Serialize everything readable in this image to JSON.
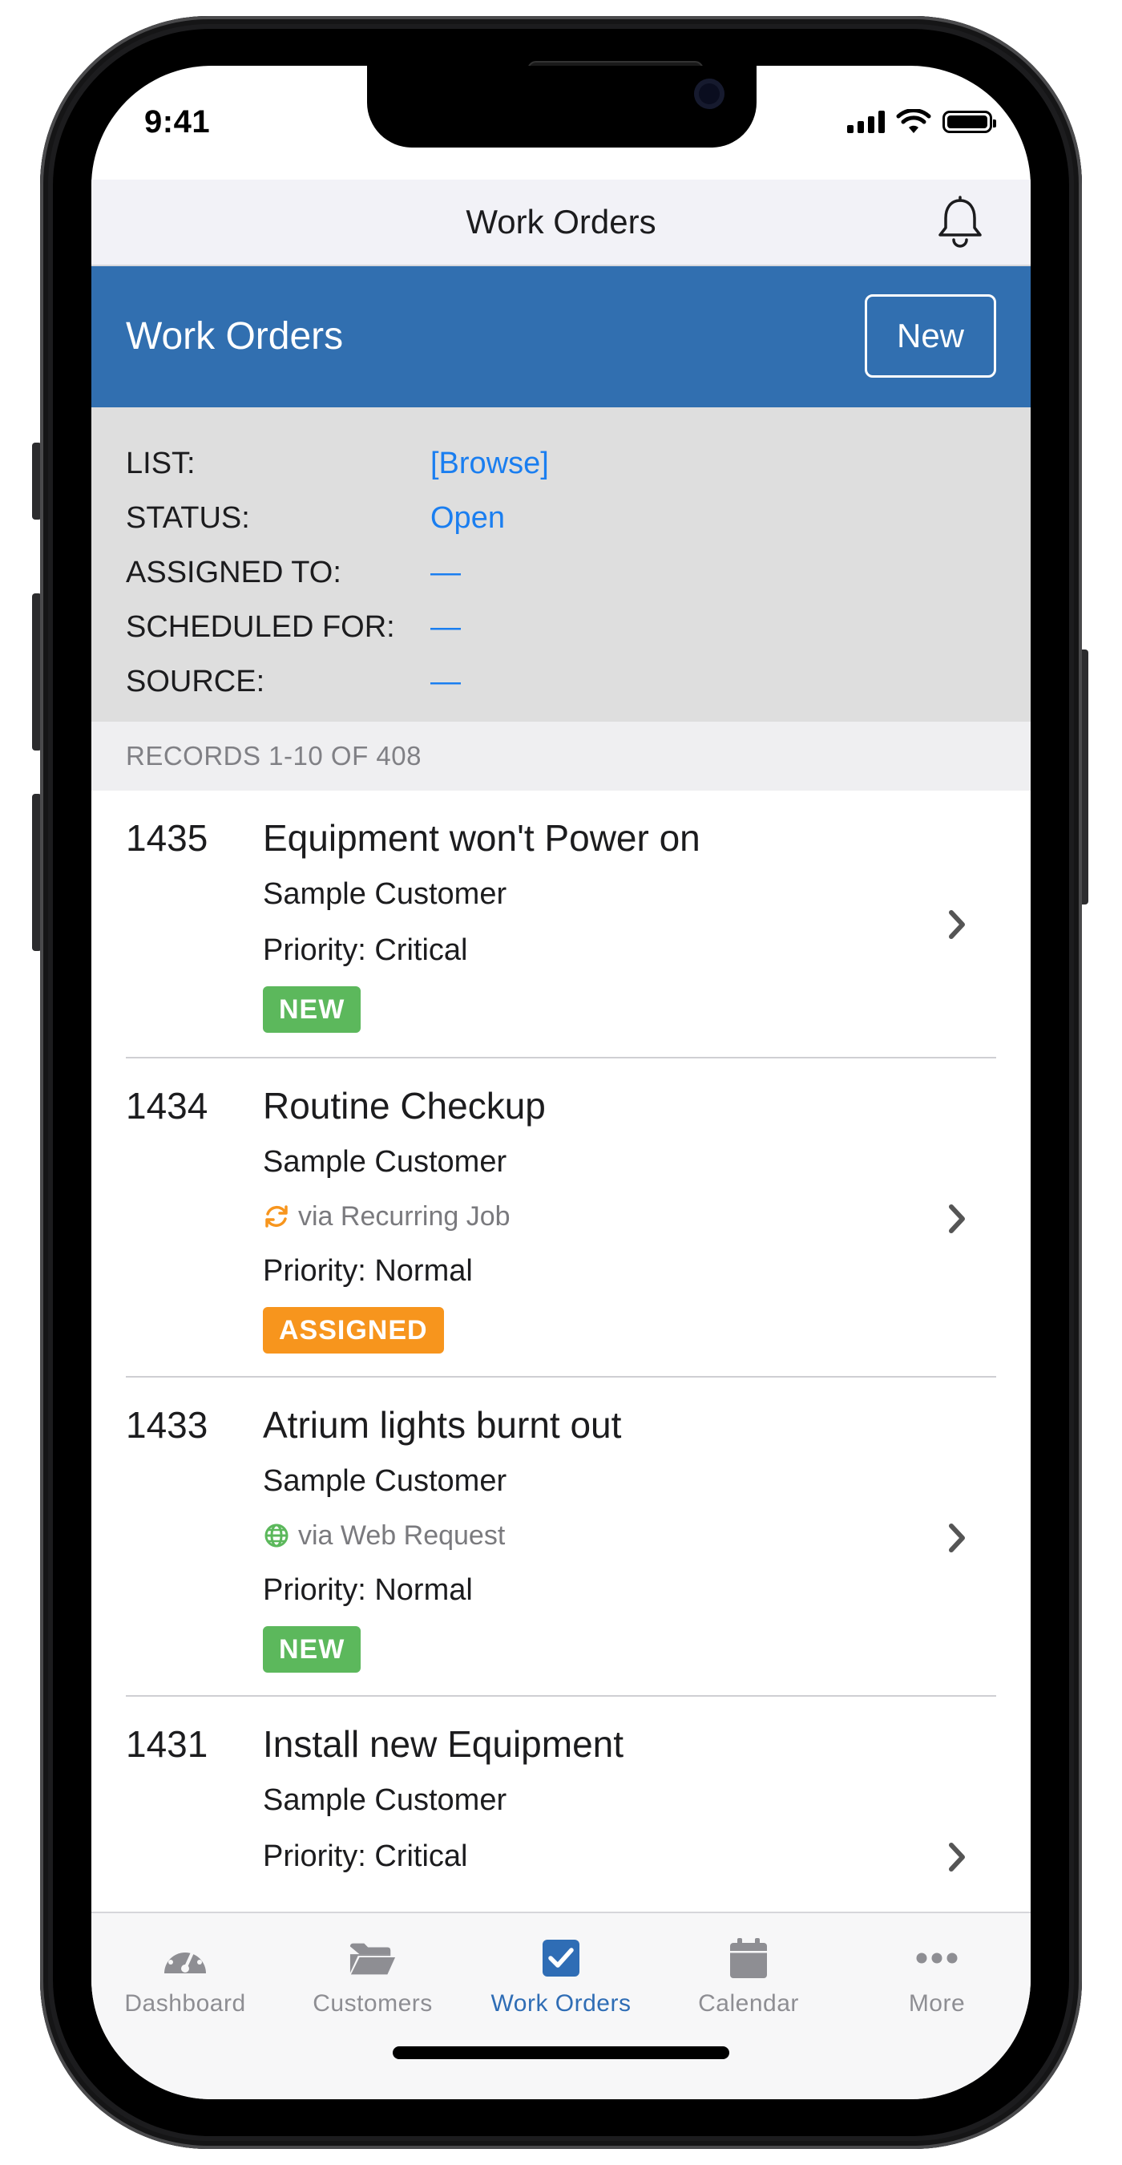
{
  "status_bar": {
    "time": "9:41"
  },
  "navbar": {
    "title": "Work Orders"
  },
  "header": {
    "title": "Work Orders",
    "new_label": "New"
  },
  "filters": [
    {
      "label": "LIST:",
      "value": "[Browse]"
    },
    {
      "label": "STATUS:",
      "value": "Open"
    },
    {
      "label": "ASSIGNED TO:",
      "value": "—"
    },
    {
      "label": "SCHEDULED FOR:",
      "value": "—"
    },
    {
      "label": "SOURCE:",
      "value": "—"
    }
  ],
  "records_summary": "RECORDS 1-10 OF 408",
  "work_orders": [
    {
      "number": "1435",
      "title": "Equipment won't Power on",
      "customer": "Sample Customer",
      "source": "",
      "priority": "Priority: Critical",
      "status": "NEW"
    },
    {
      "number": "1434",
      "title": "Routine Checkup",
      "customer": "Sample Customer",
      "source": "via Recurring Job",
      "source_icon": "recurring-icon",
      "priority": "Priority: Normal",
      "status": "ASSIGNED"
    },
    {
      "number": "1433",
      "title": "Atrium lights burnt out",
      "customer": "Sample Customer",
      "source": "via Web Request",
      "source_icon": "globe-icon",
      "priority": "Priority: Normal",
      "status": "NEW"
    },
    {
      "number": "1431",
      "title": "Install new Equipment",
      "customer": "Sample Customer",
      "source": "",
      "priority": "Priority: Critical",
      "status": ""
    }
  ],
  "tabs": [
    {
      "label": "Dashboard",
      "icon": "dashboard-icon"
    },
    {
      "label": "Customers",
      "icon": "folder-icon"
    },
    {
      "label": "Work Orders",
      "icon": "checkbox-icon",
      "active": true
    },
    {
      "label": "Calendar",
      "icon": "calendar-icon"
    },
    {
      "label": "More",
      "icon": "more-icon"
    }
  ],
  "colors": {
    "header_blue": "#316fb0",
    "link_blue": "#1a7ef0",
    "badge_new": "#5cb85c",
    "badge_assigned": "#f7951d",
    "tab_active": "#2f6db5",
    "tab_inactive": "#8e8e93"
  }
}
